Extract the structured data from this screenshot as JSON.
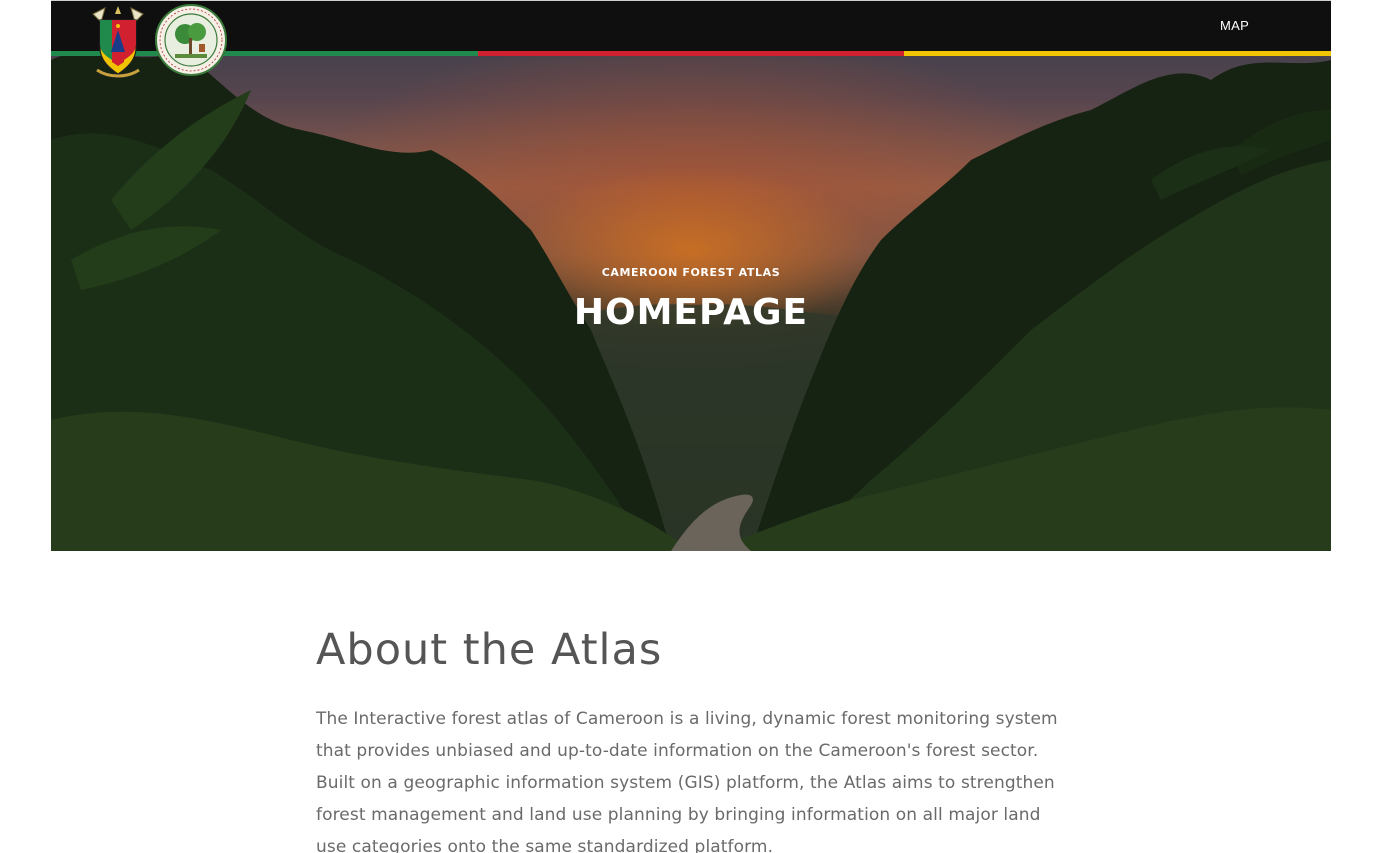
{
  "header": {
    "nav": {
      "map_label": "MAP"
    },
    "flag_colors": [
      "#1f8a4c",
      "#d1202f",
      "#f2c400"
    ],
    "logos": [
      {
        "icon": "coat-of-arms-icon",
        "alt": "Cameroon coat of arms"
      },
      {
        "icon": "ministry-seal-icon",
        "alt": "Ministry of Forestry and Wildlife seal"
      }
    ]
  },
  "hero": {
    "kicker": "CAMEROON FOREST ATLAS",
    "title": "HOMEPAGE"
  },
  "about": {
    "heading": "About the Atlas",
    "body": "The Interactive forest atlas of Cameroon is a living, dynamic forest monitoring system that provides unbiased and up-to-date information on the Cameroon's forest sector. Built on a geographic information system (GIS) platform, the Atlas aims to strengthen forest management and land use planning by bringing information on all major land use categories onto the same standardized platform."
  }
}
